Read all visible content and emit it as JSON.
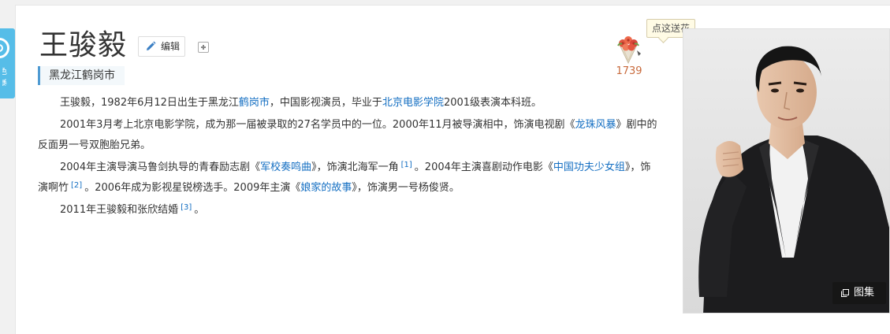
{
  "side_tab": {
    "line1": "色",
    "line2": "暴",
    "accent": "#56bde8"
  },
  "header": {
    "title": "王骏毅",
    "edit_label": "编辑",
    "subtitle": "黑龙江鹤岗市"
  },
  "flower": {
    "tooltip": "点这送花",
    "count": "1739"
  },
  "summary": {
    "p1": {
      "t1": "王骏毅，1982年6月12日出生于黑龙江",
      "link1": "鹤岗市",
      "t2": "，中国影视演员，毕业于",
      "link2": "北京电影学院",
      "t3": "2001级表演本科班。"
    },
    "p2": {
      "t1": "2001年3月考上北京电影学院，成为那一届被录取的27名学员中的一位。2000年11月被导演相中，饰演电视剧《",
      "link1": "龙珠风暴",
      "t2": "》剧中的反面男一号双胞胎兄弟。"
    },
    "p3": {
      "t1": "2004年主演导演马鲁剑执导的青春励志剧《",
      "link1": "军校奏鸣曲",
      "t2": "》，饰演北海军一角",
      "ref1": "[1]",
      "t3": "。2004年主演喜剧动作电影《",
      "link2": "中国功夫少女组",
      "t4": "》，饰演啊竹",
      "ref2": "[2]",
      "t5": "。2006年成为影视星锐榜选手。2009年主演《",
      "link3": "娘家的故事",
      "t6": "》，饰演男一号杨俊贤。"
    },
    "p4": {
      "t1": "2011年王骏毅和张欣结婚",
      "ref1": "[3]",
      "t2": "。"
    }
  },
  "album": {
    "label": "图集"
  },
  "colors": {
    "link": "#136ec2",
    "subtitle_bar": "#4e9ad2",
    "flower_count": "#c86a3c"
  }
}
